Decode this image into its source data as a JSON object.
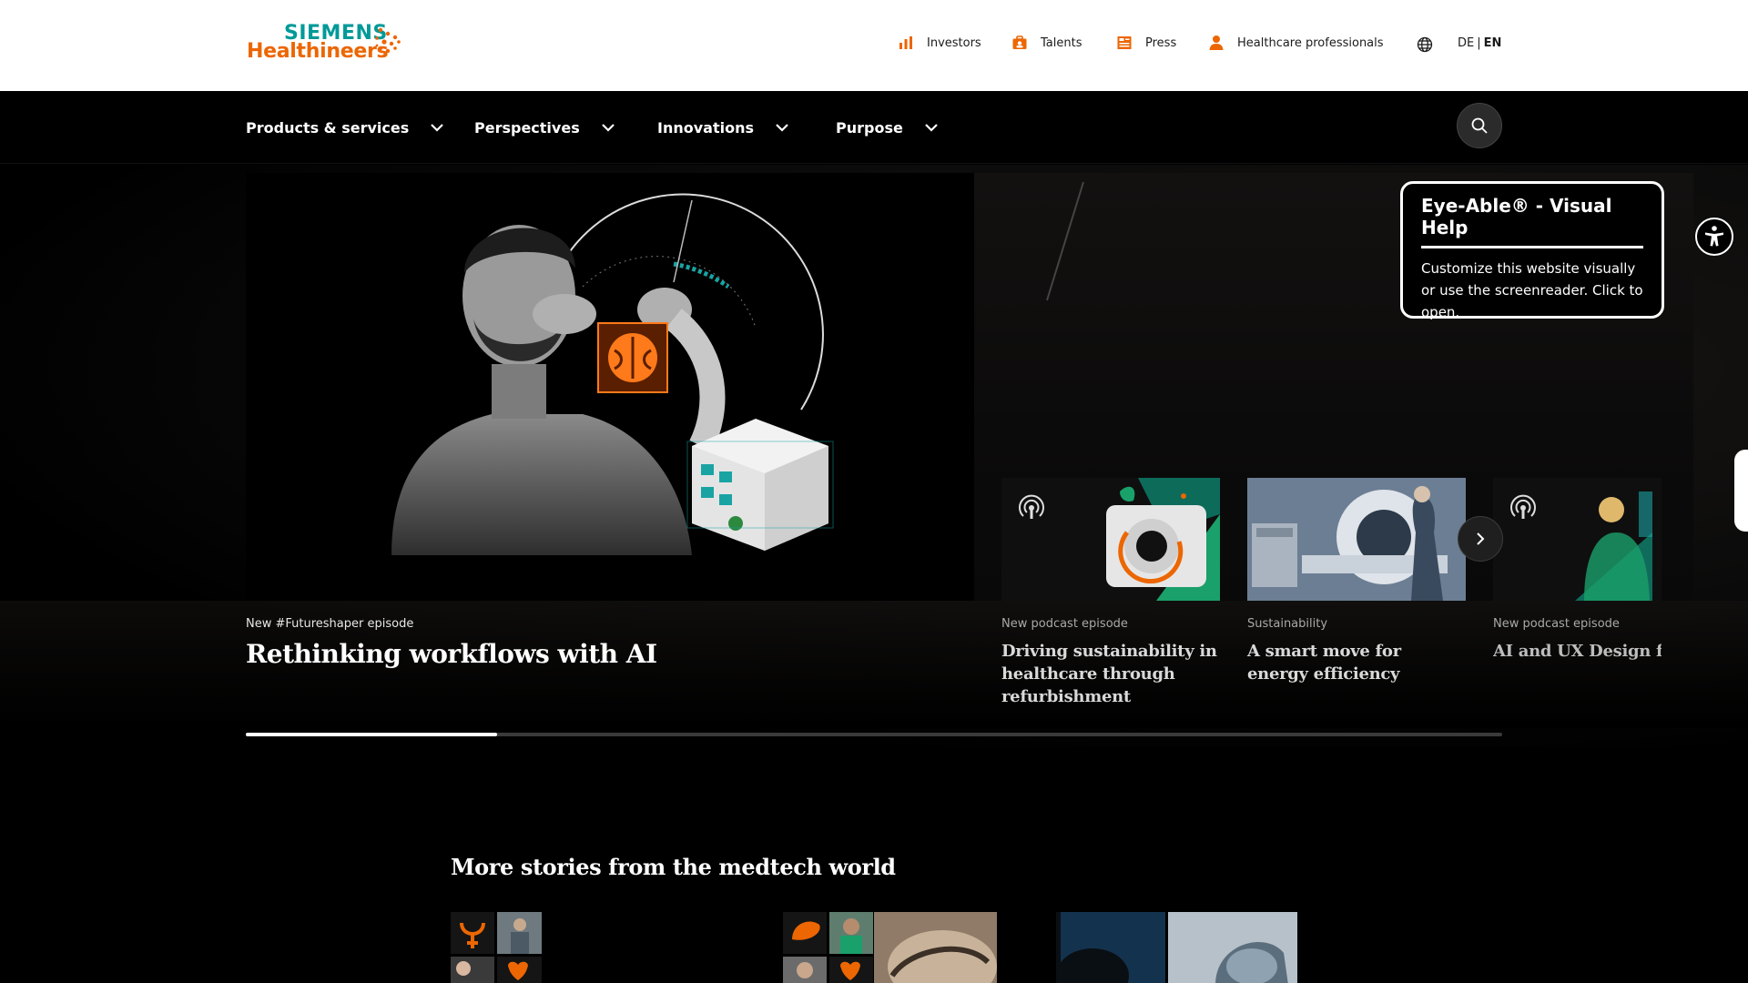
{
  "brand": {
    "line1": "SIEMENS",
    "line2": "Healthineers",
    "teal": "#009999",
    "orange": "#ec6602"
  },
  "utility_nav": {
    "items": [
      {
        "label": "Investors",
        "icon": "bar-chart-icon"
      },
      {
        "label": "Talents",
        "icon": "briefcase-icon"
      },
      {
        "label": "Press",
        "icon": "newspaper-icon"
      },
      {
        "label": "Healthcare professionals",
        "icon": "person-icon"
      }
    ],
    "language": {
      "icon": "globe-icon",
      "options": [
        "DE",
        "EN"
      ],
      "separator": "|",
      "active": "EN"
    }
  },
  "main_nav": {
    "items": [
      {
        "label": "Products & services"
      },
      {
        "label": "Perspectives"
      },
      {
        "label": "Innovations"
      },
      {
        "label": "Purpose"
      }
    ],
    "search_icon": "search-icon"
  },
  "hero": {
    "kicker": "New #Futureshaper episode",
    "title": "Rethinking workflows with AI",
    "slides": [
      {
        "kicker": "New podcast episode",
        "title": "Driving sustainability in healthcare through refurbishment",
        "icon": "podcast-icon"
      },
      {
        "kicker": "Sustainability",
        "title": "A smart move for energy efficiency"
      },
      {
        "kicker": "New podcast episode",
        "title": "AI and UX Design for Imaging Automation",
        "icon": "podcast-icon"
      }
    ],
    "progress": 0.2
  },
  "accessibility": {
    "title": "Eye-Able® - Visual Help",
    "body": "Customize this website visually or use the screenreader. Click to open.",
    "icon": "accessibility-icon"
  },
  "stories": {
    "title": "More stories from the medtech world"
  }
}
